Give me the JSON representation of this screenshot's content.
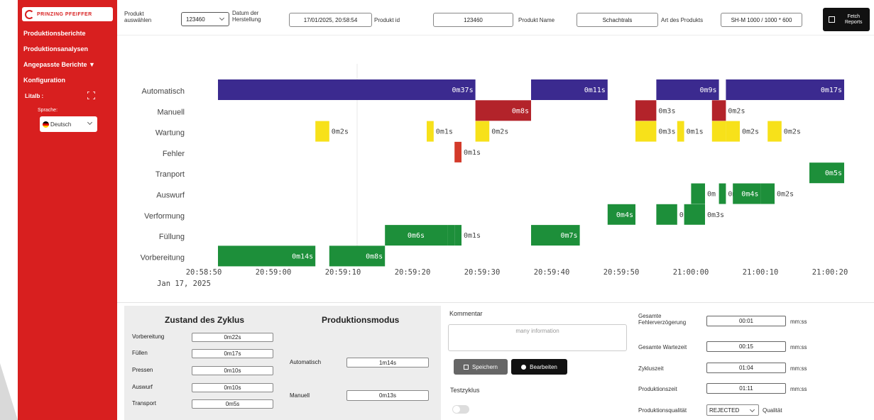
{
  "sidebar": {
    "logo_text": "PRINZING PFEIFFER",
    "nav": [
      "Produktionsberichte",
      "Produktionsanalysen",
      "Angepasste Berichte ▼",
      "Konfiguration"
    ],
    "litalb_label": "Litalb :",
    "language_label": "Sprache:",
    "language_value": "Deutsch"
  },
  "topbar": {
    "produkt_label_1": "Produkt",
    "produkt_label_2": "auswählen",
    "produkt_value": "123460",
    "datum_label_1": "Datum der",
    "datum_label_2": "Herstellung",
    "datum_value": "17/01/2025, 20:58:54",
    "produkt_id_label": "Produkt id",
    "produkt_id_value": "123460",
    "produkt_name_label": "Produkt Name",
    "produkt_name_value": "Schachtrals",
    "art_label": "Art des Produkts",
    "art_value": "SH-M 1000 / 1000 * 600",
    "fetch_label_1": "Fetch",
    "fetch_label_2": "Reports"
  },
  "chart_data": {
    "type": "timeline",
    "categories": [
      "Automatisch",
      "Manuell",
      "Wartung",
      "Fehler",
      "Tranport",
      "Auswurf",
      "Verformung",
      "Füllung",
      "Vorbereitung"
    ],
    "x_tick_labels": [
      "20:58:50",
      "20:59:00",
      "20:59:10",
      "20:59:20",
      "20:59:30",
      "20:59:40",
      "20:59:50",
      "21:00:00",
      "21:00:10",
      "21:00:20"
    ],
    "x_date_label": "Jan 17, 2025",
    "colors": {
      "Automatisch": "#3b2a8f",
      "Manuell": "#b3232a",
      "Wartung": "#f7e11a",
      "Fehler": "#d33a2a",
      "Tranport": "#1d8f3a",
      "Auswurf": "#1d8f3a",
      "Verformung": "#1d8f3a",
      "Füllung": "#1d8f3a",
      "Vorbereitung": "#1d8f3a"
    },
    "bars": [
      {
        "row": "Automatisch",
        "start": "20:58:50",
        "end": "20:59:27",
        "label": "0m37s",
        "label_pos": "inside"
      },
      {
        "row": "Automatisch",
        "start": "20:59:35",
        "end": "20:59:46",
        "label": "0m11s",
        "label_pos": "inside"
      },
      {
        "row": "Automatisch",
        "start": "20:59:53",
        "end": "21:00:02",
        "label": "0m9s",
        "label_pos": "inside"
      },
      {
        "row": "Automatisch",
        "start": "21:00:03",
        "end": "21:00:20",
        "label": "0m17s",
        "label_pos": "inside"
      },
      {
        "row": "Manuell",
        "start": "20:59:27",
        "end": "20:59:35",
        "label": "0m8s",
        "label_pos": "inside"
      },
      {
        "row": "Manuell",
        "start": "20:59:50",
        "end": "20:59:53",
        "label": "0m3s",
        "label_pos": "outside"
      },
      {
        "row": "Manuell",
        "start": "21:00:01",
        "end": "21:00:03",
        "label": "0m2s",
        "label_pos": "outside"
      },
      {
        "row": "Wartung",
        "start": "20:59:04",
        "end": "20:59:06",
        "label": "0m2s",
        "label_pos": "outside"
      },
      {
        "row": "Wartung",
        "start": "20:59:20",
        "end": "20:59:21",
        "label": "0m1s",
        "label_pos": "outside"
      },
      {
        "row": "Wartung",
        "start": "20:59:27",
        "end": "20:59:29",
        "label": "0m2s",
        "label_pos": "outside"
      },
      {
        "row": "Wartung",
        "start": "20:59:50",
        "end": "20:59:53",
        "label": "0m3s",
        "label_pos": "outside"
      },
      {
        "row": "Wartung",
        "start": "20:59:56",
        "end": "20:59:57",
        "label": "0m1s",
        "label_pos": "outside"
      },
      {
        "row": "Wartung",
        "start": "21:00:01",
        "end": "21:00:03",
        "label": "0m",
        "label_pos": "outside"
      },
      {
        "row": "Wartung",
        "start": "21:00:03",
        "end": "21:00:05",
        "label": "0m2s",
        "label_pos": "outside"
      },
      {
        "row": "Wartung",
        "start": "21:00:09",
        "end": "21:00:11",
        "label": "0m2s",
        "label_pos": "outside"
      },
      {
        "row": "Fehler",
        "start": "20:59:24",
        "end": "20:59:25",
        "label": "0m1s",
        "label_pos": "outside"
      },
      {
        "row": "Tranport",
        "start": "21:00:15",
        "end": "21:00:20",
        "label": "0m5s",
        "label_pos": "inside"
      },
      {
        "row": "Auswurf",
        "start": "20:59:58",
        "end": "21:00:00",
        "label": "0m",
        "label_pos": "outside"
      },
      {
        "row": "Auswurf",
        "start": "21:00:02",
        "end": "21:00:03",
        "label": "0m",
        "label_pos": "outside"
      },
      {
        "row": "Auswurf",
        "start": "21:00:04",
        "end": "21:00:08",
        "label": "0m4s",
        "label_pos": "inside"
      },
      {
        "row": "Auswurf",
        "start": "21:00:08",
        "end": "21:00:10",
        "label": "0m2s",
        "label_pos": "outside"
      },
      {
        "row": "Verformung",
        "start": "20:59:46",
        "end": "20:59:50",
        "label": "0m4s",
        "label_pos": "inside"
      },
      {
        "row": "Verformung",
        "start": "20:59:53",
        "end": "20:59:56",
        "label": "0",
        "label_pos": "outside"
      },
      {
        "row": "Verformung",
        "start": "20:59:57",
        "end": "21:00:00",
        "label": "0m3s",
        "label_pos": "outside"
      },
      {
        "row": "Füllung",
        "start": "20:59:14",
        "end": "20:59:20",
        "label": "0m6s",
        "label_pos": "inside"
      },
      {
        "row": "Füllung",
        "start": "20:59:20",
        "end": "20:59:23",
        "label": "",
        "label_pos": "none"
      },
      {
        "row": "Füllung",
        "start": "20:59:23",
        "end": "20:59:24",
        "label": "0",
        "label_pos": "outside"
      },
      {
        "row": "Füllung",
        "start": "20:59:24",
        "end": "20:59:25",
        "label": "0m1s",
        "label_pos": "outside"
      },
      {
        "row": "Füllung",
        "start": "20:59:35",
        "end": "20:59:42",
        "label": "0m7s",
        "label_pos": "inside"
      },
      {
        "row": "Vorbereitung",
        "start": "20:58:50",
        "end": "20:59:04",
        "label": "0m14s",
        "label_pos": "inside"
      },
      {
        "row": "Vorbereitung",
        "start": "20:59:06",
        "end": "20:59:14",
        "label": "0m8s",
        "label_pos": "inside"
      }
    ]
  },
  "zustand": {
    "title": "Zustand des Zyklus",
    "rows": [
      {
        "label": "Vorbereitung",
        "value": "0m22s"
      },
      {
        "label": "Füllen",
        "value": "0m17s"
      },
      {
        "label": "Pressen",
        "value": "0m10s"
      },
      {
        "label": "Auswurf",
        "value": "0m10s"
      },
      {
        "label": "Transport",
        "value": "0m5s"
      }
    ]
  },
  "produktionsmodus": {
    "title": "Produktionsmodus",
    "rows": [
      {
        "label": "Automatisch",
        "value": "1m14s"
      },
      {
        "label": "Manuell",
        "value": "0m13s"
      }
    ]
  },
  "kommentar": {
    "label": "Kommentar",
    "placeholder": "many information",
    "save_label": "Speichern",
    "edit_label": "Bearbeiten",
    "testzyklus_label": "Testzyklus"
  },
  "metrics": {
    "fehler_label_1": "Gesamte",
    "fehler_label_2": "Fehlerverzögerung",
    "fehler_value": "00:01",
    "warte_label": "Gesamte Wartezeit",
    "warte_value": "00:15",
    "zyklus_label": "Zykluszeit",
    "zyklus_value": "01:04",
    "produktion_label": "Produktionszeit",
    "produktion_value": "01:11",
    "unit": "mm:ss",
    "qualitaet_label": "Produktionsqualität",
    "qualitaet_value": "REJECTED",
    "qualitaet_suffix": "Qualität"
  }
}
